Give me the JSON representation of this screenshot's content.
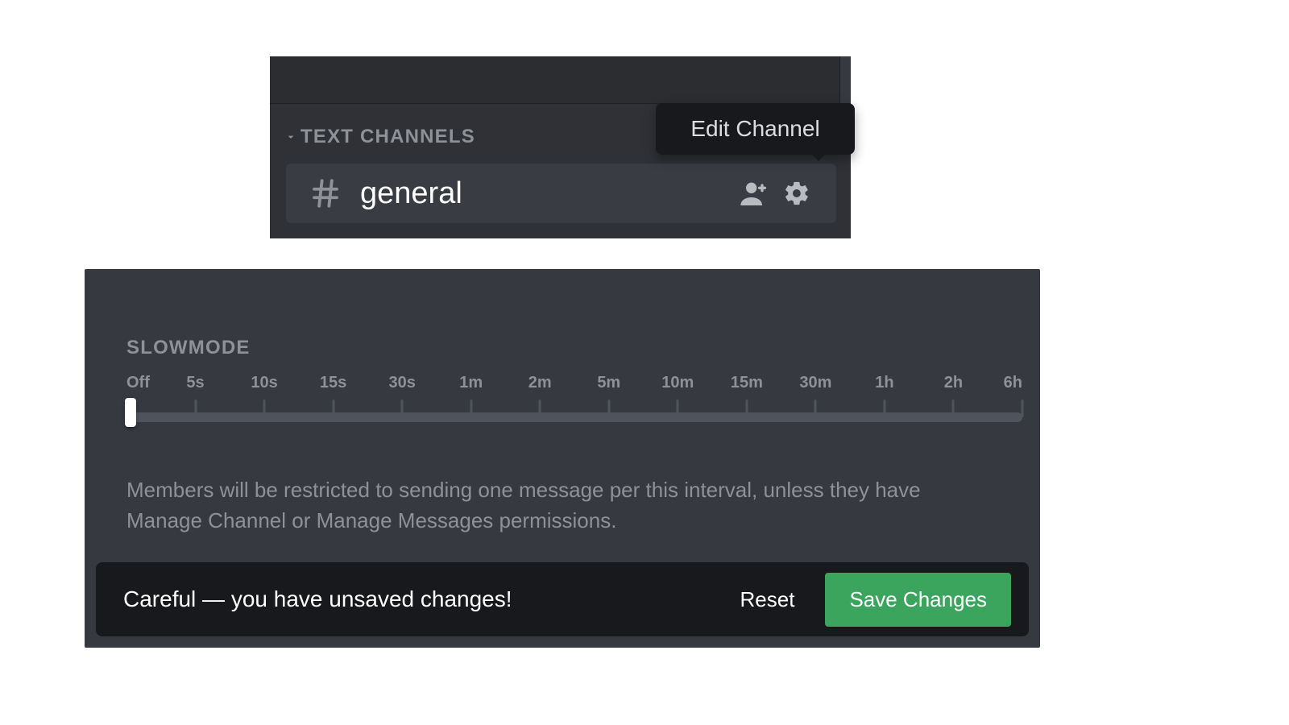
{
  "sidebar": {
    "category_label": "TEXT CHANNELS",
    "channel_name": "general",
    "tooltip": "Edit Channel"
  },
  "slowmode": {
    "title": "SLOWMODE",
    "marks": [
      "Off",
      "5s",
      "10s",
      "15s",
      "30s",
      "1m",
      "2m",
      "5m",
      "10m",
      "15m",
      "30m",
      "1h",
      "2h",
      "6h"
    ],
    "selected_index": 0,
    "description": "Members will be restricted to sending one message per this interval, unless they have Manage Channel or Manage Messages permissions."
  },
  "save_bar": {
    "message": "Careful — you have unsaved changes!",
    "reset_label": "Reset",
    "save_label": "Save Changes"
  },
  "colors": {
    "accent_green": "#3ba55d",
    "bg_dark": "#36393f",
    "bg_darker": "#2f3136",
    "tooltip_bg": "#18191c"
  }
}
